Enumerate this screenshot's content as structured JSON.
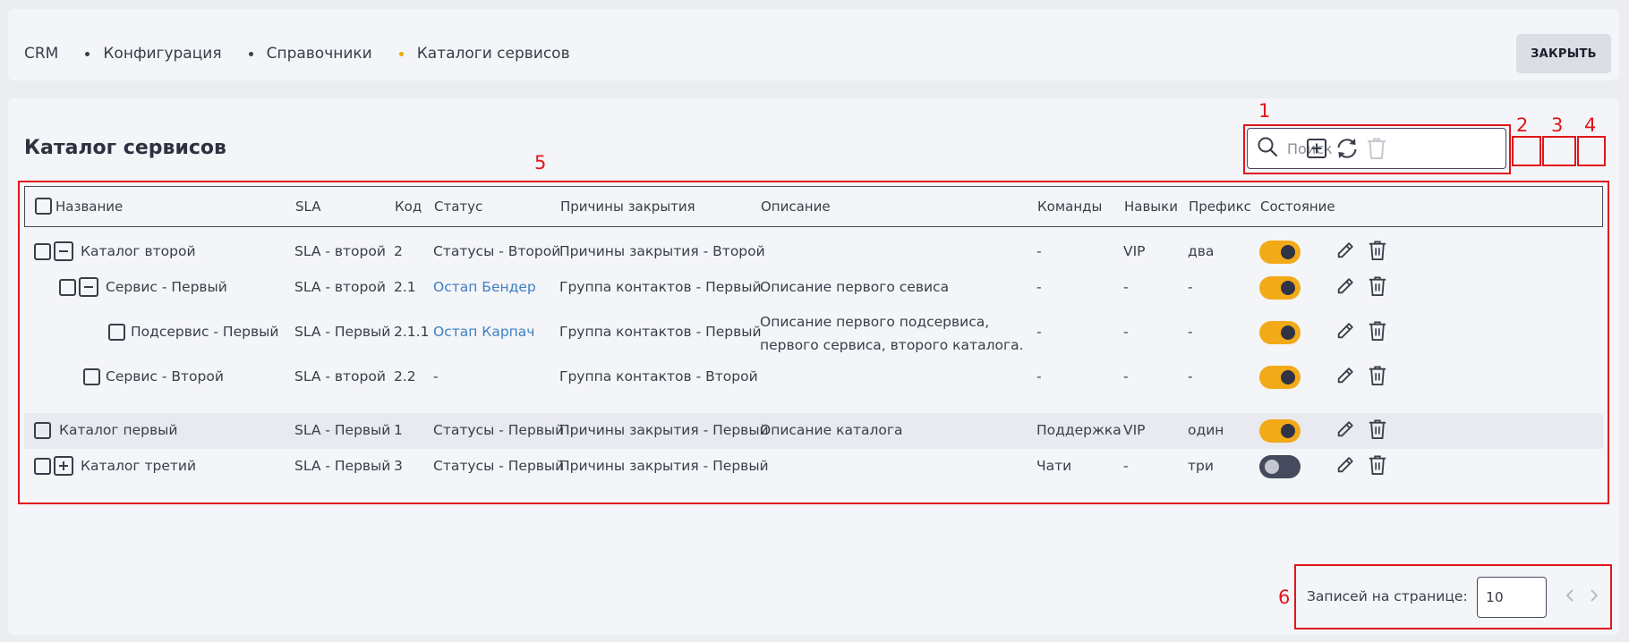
{
  "breadcrumb": [
    "CRM",
    "Конфигурация",
    "Справочники",
    "Каталоги сервисов"
  ],
  "close_label": "ЗАКРЫТЬ",
  "title": "Каталог сервисов",
  "search": {
    "placeholder": "Поиск",
    "value": ""
  },
  "columns": [
    "Название",
    "SLA",
    "Код",
    "Статус",
    "Причины закрытия",
    "Описание",
    "Команды",
    "Навыки",
    "Префикс",
    "Состояние"
  ],
  "rows": [
    {
      "name": "Каталог второй",
      "sla": "SLA - второй",
      "code": "2",
      "status": "Статусы - Второй",
      "reasons": "Причины закрытия - Второй",
      "desc": "",
      "teams": "-",
      "skills": "VIP",
      "prefix": "два",
      "enabled": true,
      "expander": "minus"
    },
    {
      "name": "Сервис - Первый",
      "sla": "SLA - второй",
      "code": "2.1",
      "status": "Остап Бендер",
      "reasons": "Группа контактов - Первый",
      "desc": "Описание первого севиса",
      "teams": "-",
      "skills": "-",
      "prefix": "-",
      "enabled": true,
      "expander": "minus"
    },
    {
      "name": "Подсервис - Первый",
      "sla": "SLA - Первый",
      "code": "2.1.1",
      "status": "Остап Карпач",
      "reasons": "Группа контактов - Первый",
      "desc": "Описание первого подсервиса, первого сервиса, второго каталога.",
      "teams": "-",
      "skills": "-",
      "prefix": "-",
      "enabled": true,
      "expander": ""
    },
    {
      "name": "Сервис - Второй",
      "sla": "SLA - второй",
      "code": "2.2",
      "status": "-",
      "reasons": "Группа контактов - Второй",
      "desc": "",
      "teams": "-",
      "skills": "-",
      "prefix": "-",
      "enabled": true,
      "expander": ""
    },
    {
      "name": "Каталог первый",
      "sla": "SLA - Первый",
      "code": "1",
      "status": "Статусы - Первый",
      "reasons": "Причины закрытия - Первый",
      "desc": "Описание каталога",
      "teams": "Поддержка",
      "skills": "VIP",
      "prefix": "один",
      "enabled": true,
      "expander": ""
    },
    {
      "name": "Каталог третий",
      "sla": "SLA - Первый",
      "code": "3",
      "status": "Статусы - Первый",
      "reasons": "Причины закрытия - Первый",
      "desc": "",
      "teams": "Чати",
      "skills": "-",
      "prefix": "три",
      "enabled": false,
      "expander": "plus"
    }
  ],
  "pager": {
    "label": "Записей на странице:",
    "value": "10"
  },
  "annotations": [
    "1",
    "2",
    "3",
    "4",
    "5",
    "6"
  ],
  "colors": {
    "accent": "#f3aa19",
    "link": "#3d7fc2",
    "annotation": "#e0161b"
  },
  "icons": [
    "search-icon",
    "add-icon",
    "refresh-icon",
    "delete-icon",
    "edit-icon",
    "trash-icon",
    "chevron-left-icon",
    "chevron-right-icon"
  ]
}
